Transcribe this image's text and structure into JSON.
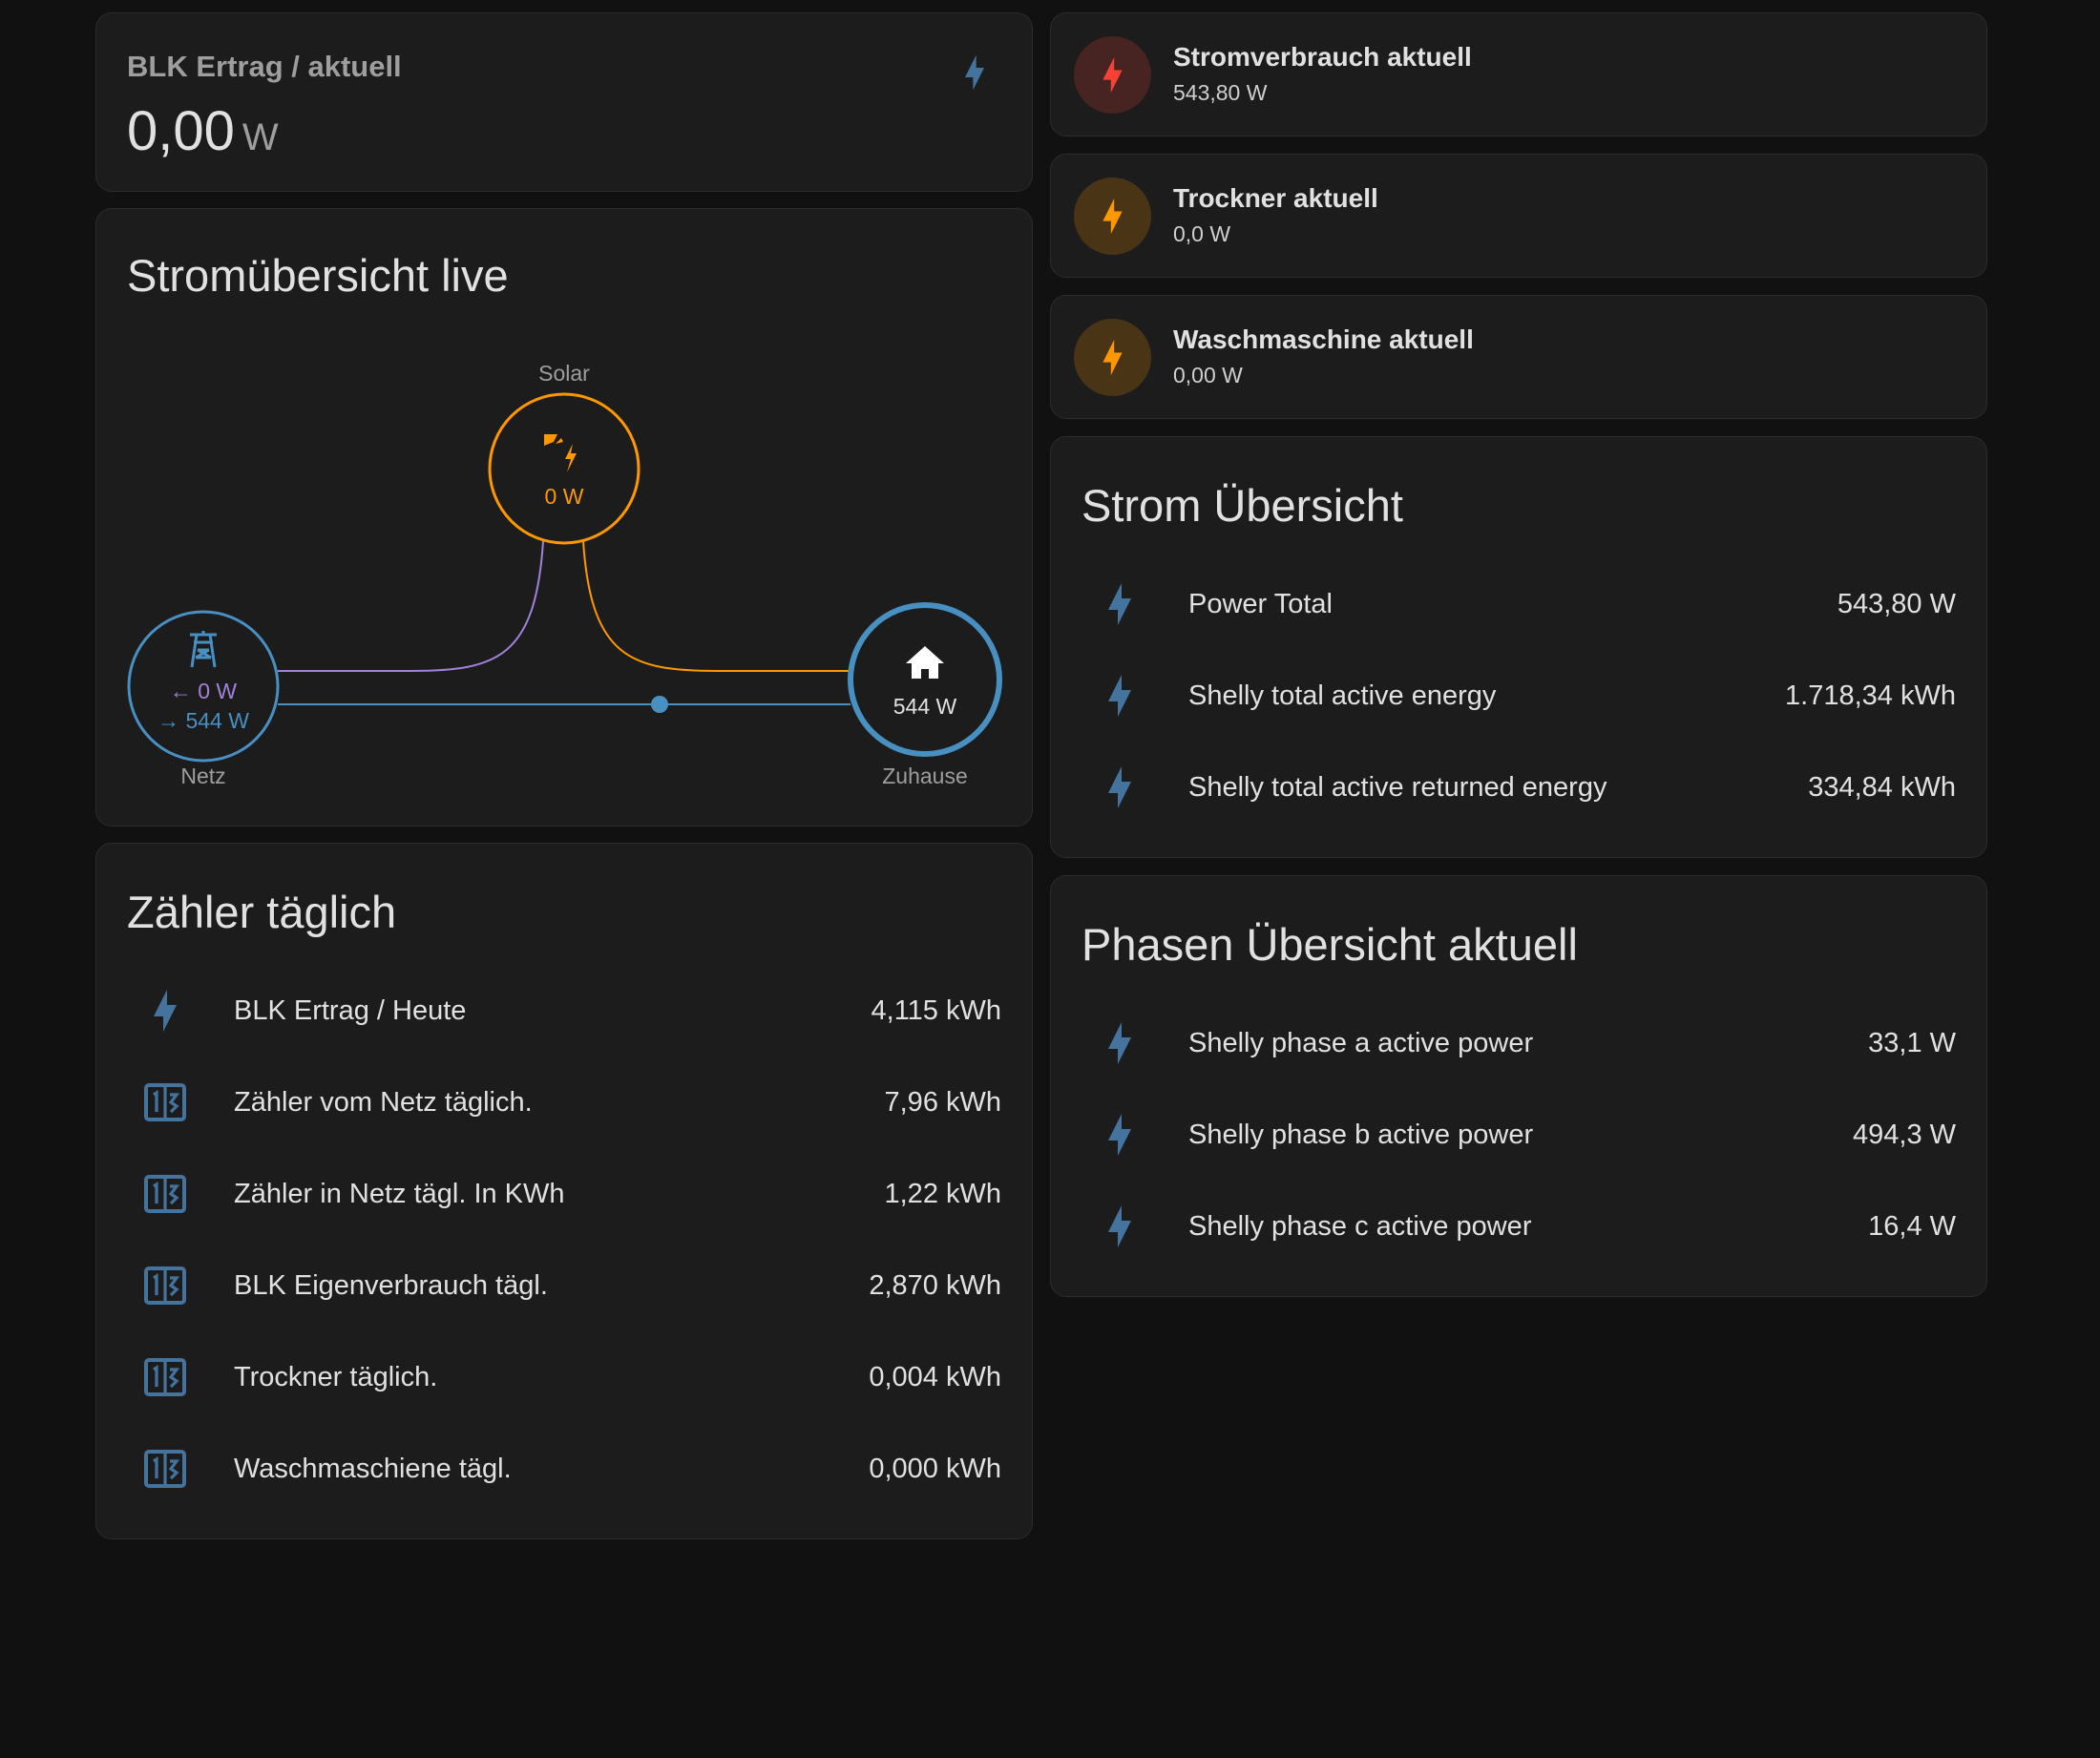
{
  "sensor_card": {
    "name": "BLK Ertrag / aktuell",
    "value": "0,00",
    "unit": "W",
    "icon": "lightning-bolt-icon"
  },
  "flow_card": {
    "title": "Stromübersicht live",
    "solar": {
      "label": "Solar",
      "value": "0 W",
      "icon": "solar-power-icon",
      "color": "#ff9800"
    },
    "grid": {
      "label": "Netz",
      "return_value": "0 W",
      "consume_value": "544 W",
      "icon": "transmission-tower-icon",
      "return_color": "#a280db",
      "consume_color": "#488fc2"
    },
    "home": {
      "label": "Zuhause",
      "value": "544 W",
      "icon": "home-icon",
      "color": "#488fc2"
    }
  },
  "daily_card": {
    "title": "Zähler täglich",
    "rows": [
      {
        "name": "BLK Ertrag / Heute",
        "value": "4,115 kWh",
        "icon": "lightning-bolt-icon"
      },
      {
        "name": "Zähler vom Netz täglich.",
        "value": "7,96 kWh",
        "icon": "counter-icon"
      },
      {
        "name": "Zähler in Netz tägl. In KWh",
        "value": "1,22 kWh",
        "icon": "counter-icon"
      },
      {
        "name": "BLK Eigenverbrauch tägl.",
        "value": "2,870 kWh",
        "icon": "counter-icon"
      },
      {
        "name": "Trockner täglich.",
        "value": "0,004 kWh",
        "icon": "counter-icon"
      },
      {
        "name": "Waschmaschiene tägl.",
        "value": "0,000 kWh",
        "icon": "counter-icon"
      }
    ]
  },
  "tiles": [
    {
      "name": "Stromverbrauch aktuell",
      "state": "543,80 W",
      "color": "#f44336",
      "icon": "lightning-bolt-icon"
    },
    {
      "name": "Trockner aktuell",
      "state": "0,0 W",
      "color": "#ff9800",
      "icon": "lightning-bolt-icon"
    },
    {
      "name": "Waschmaschine aktuell",
      "state": "0,00 W",
      "color": "#ff9800",
      "icon": "lightning-bolt-icon"
    }
  ],
  "strom_card": {
    "title": "Strom Übersicht",
    "rows": [
      {
        "name": "Power Total",
        "value": "543,80 W",
        "icon": "lightning-bolt-icon"
      },
      {
        "name": "Shelly total active energy",
        "value": "1.718,34 kWh",
        "icon": "lightning-bolt-icon"
      },
      {
        "name": "Shelly total active returned energy",
        "value": "334,84 kWh",
        "icon": "lightning-bolt-icon"
      }
    ]
  },
  "phasen_card": {
    "title": "Phasen Übersicht aktuell",
    "rows": [
      {
        "name": "Shelly phase a active power",
        "value": "33,1 W",
        "icon": "lightning-bolt-icon"
      },
      {
        "name": "Shelly phase b active power",
        "value": "494,3 W",
        "icon": "lightning-bolt-icon"
      },
      {
        "name": "Shelly phase c active power",
        "value": "16,4 W",
        "icon": "lightning-bolt-icon"
      }
    ]
  },
  "colors": {
    "icon_blue": "#44739e",
    "card_bg": "#1c1c1c",
    "page_bg": "#111111"
  }
}
